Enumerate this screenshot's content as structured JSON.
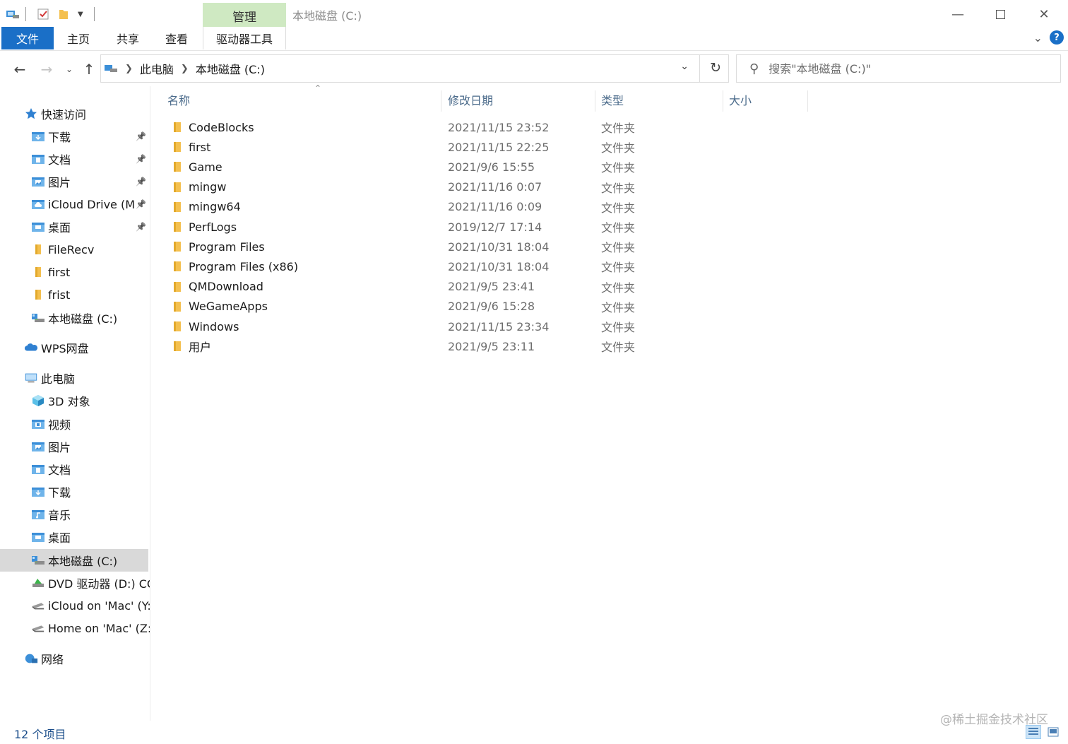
{
  "window": {
    "title": "本地磁盘 (C:)",
    "contextual_tab": "管理"
  },
  "ribbon": {
    "tabs": [
      "文件",
      "主页",
      "共享",
      "查看",
      "驱动器工具"
    ]
  },
  "address": {
    "crumbs": [
      "此电脑",
      "本地磁盘 (C:)"
    ]
  },
  "search": {
    "placeholder": "搜索\"本地磁盘 (C:)\""
  },
  "nav": {
    "items": [
      {
        "label": "快速访问",
        "icon": "star-icon"
      },
      {
        "label": "下载",
        "icon": "downloads-folder-icon",
        "pinned": true
      },
      {
        "label": "文档",
        "icon": "documents-folder-icon",
        "pinned": true
      },
      {
        "label": "图片",
        "icon": "pictures-folder-icon",
        "pinned": true
      },
      {
        "label": "iCloud Drive (M",
        "icon": "icloud-folder-icon",
        "pinned": true
      },
      {
        "label": "桌面",
        "icon": "desktop-folder-icon",
        "pinned": true
      },
      {
        "label": "FileRecv",
        "icon": "folder-icon"
      },
      {
        "label": "first",
        "icon": "folder-icon"
      },
      {
        "label": "frist",
        "icon": "folder-icon"
      },
      {
        "label": "本地磁盘 (C:)",
        "icon": "drive-icon"
      },
      {
        "label": "WPS网盘",
        "icon": "cloud-icon"
      },
      {
        "label": "此电脑",
        "icon": "computer-icon"
      },
      {
        "label": "3D 对象",
        "icon": "cube-icon"
      },
      {
        "label": "视频",
        "icon": "videos-folder-icon"
      },
      {
        "label": "图片",
        "icon": "pictures-folder-icon"
      },
      {
        "label": "文档",
        "icon": "documents-folder-icon"
      },
      {
        "label": "下载",
        "icon": "downloads-folder-icon"
      },
      {
        "label": "音乐",
        "icon": "music-folder-icon"
      },
      {
        "label": "桌面",
        "icon": "desktop-folder-icon"
      },
      {
        "label": "本地磁盘 (C:)",
        "icon": "drive-icon",
        "selected": true
      },
      {
        "label": "DVD 驱动器 (D:) CC",
        "icon": "dvd-drive-icon"
      },
      {
        "label": "iCloud on 'Mac' (Y:",
        "icon": "network-drive-icon"
      },
      {
        "label": "Home on 'Mac' (Z:",
        "icon": "network-drive-icon"
      },
      {
        "label": "网络",
        "icon": "network-icon"
      }
    ]
  },
  "columns": {
    "name": "名称",
    "date": "修改日期",
    "type": "类型",
    "size": "大小"
  },
  "files": [
    {
      "name": "CodeBlocks",
      "date": "2021/11/15 23:52",
      "type": "文件夹"
    },
    {
      "name": "first",
      "date": "2021/11/15 22:25",
      "type": "文件夹"
    },
    {
      "name": "Game",
      "date": "2021/9/6 15:55",
      "type": "文件夹"
    },
    {
      "name": "mingw",
      "date": "2021/11/16 0:07",
      "type": "文件夹"
    },
    {
      "name": "mingw64",
      "date": "2021/11/16 0:09",
      "type": "文件夹"
    },
    {
      "name": "PerfLogs",
      "date": "2019/12/7 17:14",
      "type": "文件夹"
    },
    {
      "name": "Program Files",
      "date": "2021/10/31 18:04",
      "type": "文件夹"
    },
    {
      "name": "Program Files (x86)",
      "date": "2021/10/31 18:04",
      "type": "文件夹"
    },
    {
      "name": "QMDownload",
      "date": "2021/9/5 23:41",
      "type": "文件夹"
    },
    {
      "name": "WeGameApps",
      "date": "2021/9/6 15:28",
      "type": "文件夹"
    },
    {
      "name": "Windows",
      "date": "2021/11/15 23:34",
      "type": "文件夹"
    },
    {
      "name": "用户",
      "date": "2021/9/5 23:11",
      "type": "文件夹"
    }
  ],
  "status": {
    "count": "12 个项目",
    "watermark": "@稀土掘金技术社区"
  },
  "colors": {
    "accent": "#1a6fc7",
    "contextual_tab_bg": "#cfe9c2",
    "folder": "#f4c04f",
    "selection": "#d9d9d9"
  }
}
